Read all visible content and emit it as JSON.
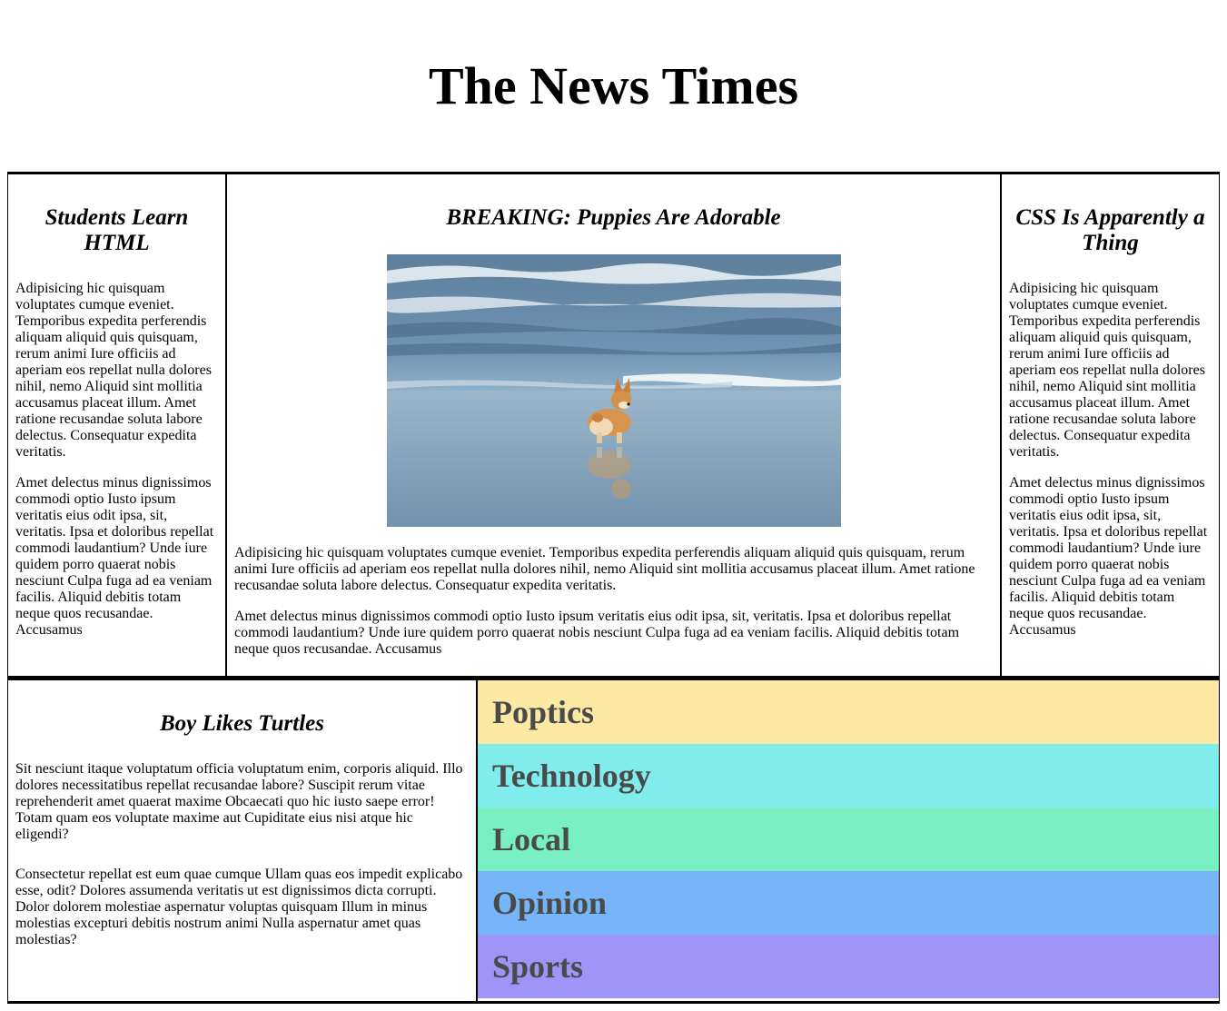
{
  "site": {
    "title": "The News Times"
  },
  "articles": {
    "left": {
      "headline": "Students Learn HTML",
      "paragraphs": [
        "Adipisicing hic quisquam voluptates cumque eveniet. Temporibus expedita perferendis aliquam aliquid quis quisquam, rerum animi Iure officiis ad aperiam eos repellat nulla dolores nihil, nemo Aliquid sint mollitia accusamus placeat illum. Amet ratione recusandae soluta labore delectus. Consequatur expedita veritatis.",
        "Amet delectus minus dignissimos commodi optio Iusto ipsum veritatis eius odit ipsa, sit, veritatis. Ipsa et doloribus repellat commodi laudantium? Unde iure quidem porro quaerat nobis nesciunt Culpa fuga ad ea veniam facilis. Aliquid debitis totam neque quos recusandae. Accusamus"
      ]
    },
    "center": {
      "headline": "BREAKING: Puppies Are Adorable",
      "image": "corgi running on beach at the water's edge",
      "paragraphs": [
        "Adipisicing hic quisquam voluptates cumque eveniet. Temporibus expedita perferendis aliquam aliquid quis quisquam, rerum animi Iure officiis ad aperiam eos repellat nulla dolores nihil, nemo Aliquid sint mollitia accusamus placeat illum. Amet ratione recusandae soluta labore delectus. Consequatur expedita veritatis.",
        "Amet delectus minus dignissimos commodi optio Iusto ipsum veritatis eius odit ipsa, sit, veritatis. Ipsa et doloribus repellat commodi laudantium? Unde iure quidem porro quaerat nobis nesciunt Culpa fuga ad ea veniam facilis. Aliquid debitis totam neque quos recusandae. Accusamus"
      ]
    },
    "right": {
      "headline": "CSS Is Apparently a Thing",
      "paragraphs": [
        "Adipisicing hic quisquam voluptates cumque eveniet. Temporibus expedita perferendis aliquam aliquid quis quisquam, rerum animi Iure officiis ad aperiam eos repellat nulla dolores nihil, nemo Aliquid sint mollitia accusamus placeat illum. Amet ratione recusandae soluta labore delectus. Consequatur expedita veritatis.",
        "Amet delectus minus dignissimos commodi optio Iusto ipsum veritatis eius odit ipsa, sit, veritatis. Ipsa et doloribus repellat commodi laudantium? Unde iure quidem porro quaerat nobis nesciunt Culpa fuga ad ea veniam facilis. Aliquid debitis totam neque quos recusandae. Accusamus"
      ]
    },
    "bottom": {
      "headline": "Boy Likes Turtles",
      "paragraphs": [
        "Sit nesciunt itaque voluptatum officia voluptatum enim, corporis aliquid. Illo dolores necessitatibus repellat recusandae labore? Suscipit rerum vitae reprehenderit amet quaerat maxime Obcaecati quo hic iusto saepe error! Totam quam eos voluptate maxime aut Cupiditate eius nisi atque hic eligendi?",
        "Consectetur repellat est eum quae cumque Ullam quas eos impedit explicabo esse, odit? Dolores assumenda veritatis ut est dignissimos dicta corrupti. Dolor dolorem molestiae aspernatur voluptas quisquam Illum in minus molestias excepturi debitis nostrum animi Nulla aspernatur amet quas molestias?"
      ]
    }
  },
  "sections": [
    {
      "label": "Poptics",
      "color": "#fbe9a4"
    },
    {
      "label": "Technology",
      "color": "#80ecec"
    },
    {
      "label": "Local",
      "color": "#78f0c4"
    },
    {
      "label": "Opinion",
      "color": "#76b6f8"
    },
    {
      "label": "Sports",
      "color": "#9f94f8"
    }
  ]
}
